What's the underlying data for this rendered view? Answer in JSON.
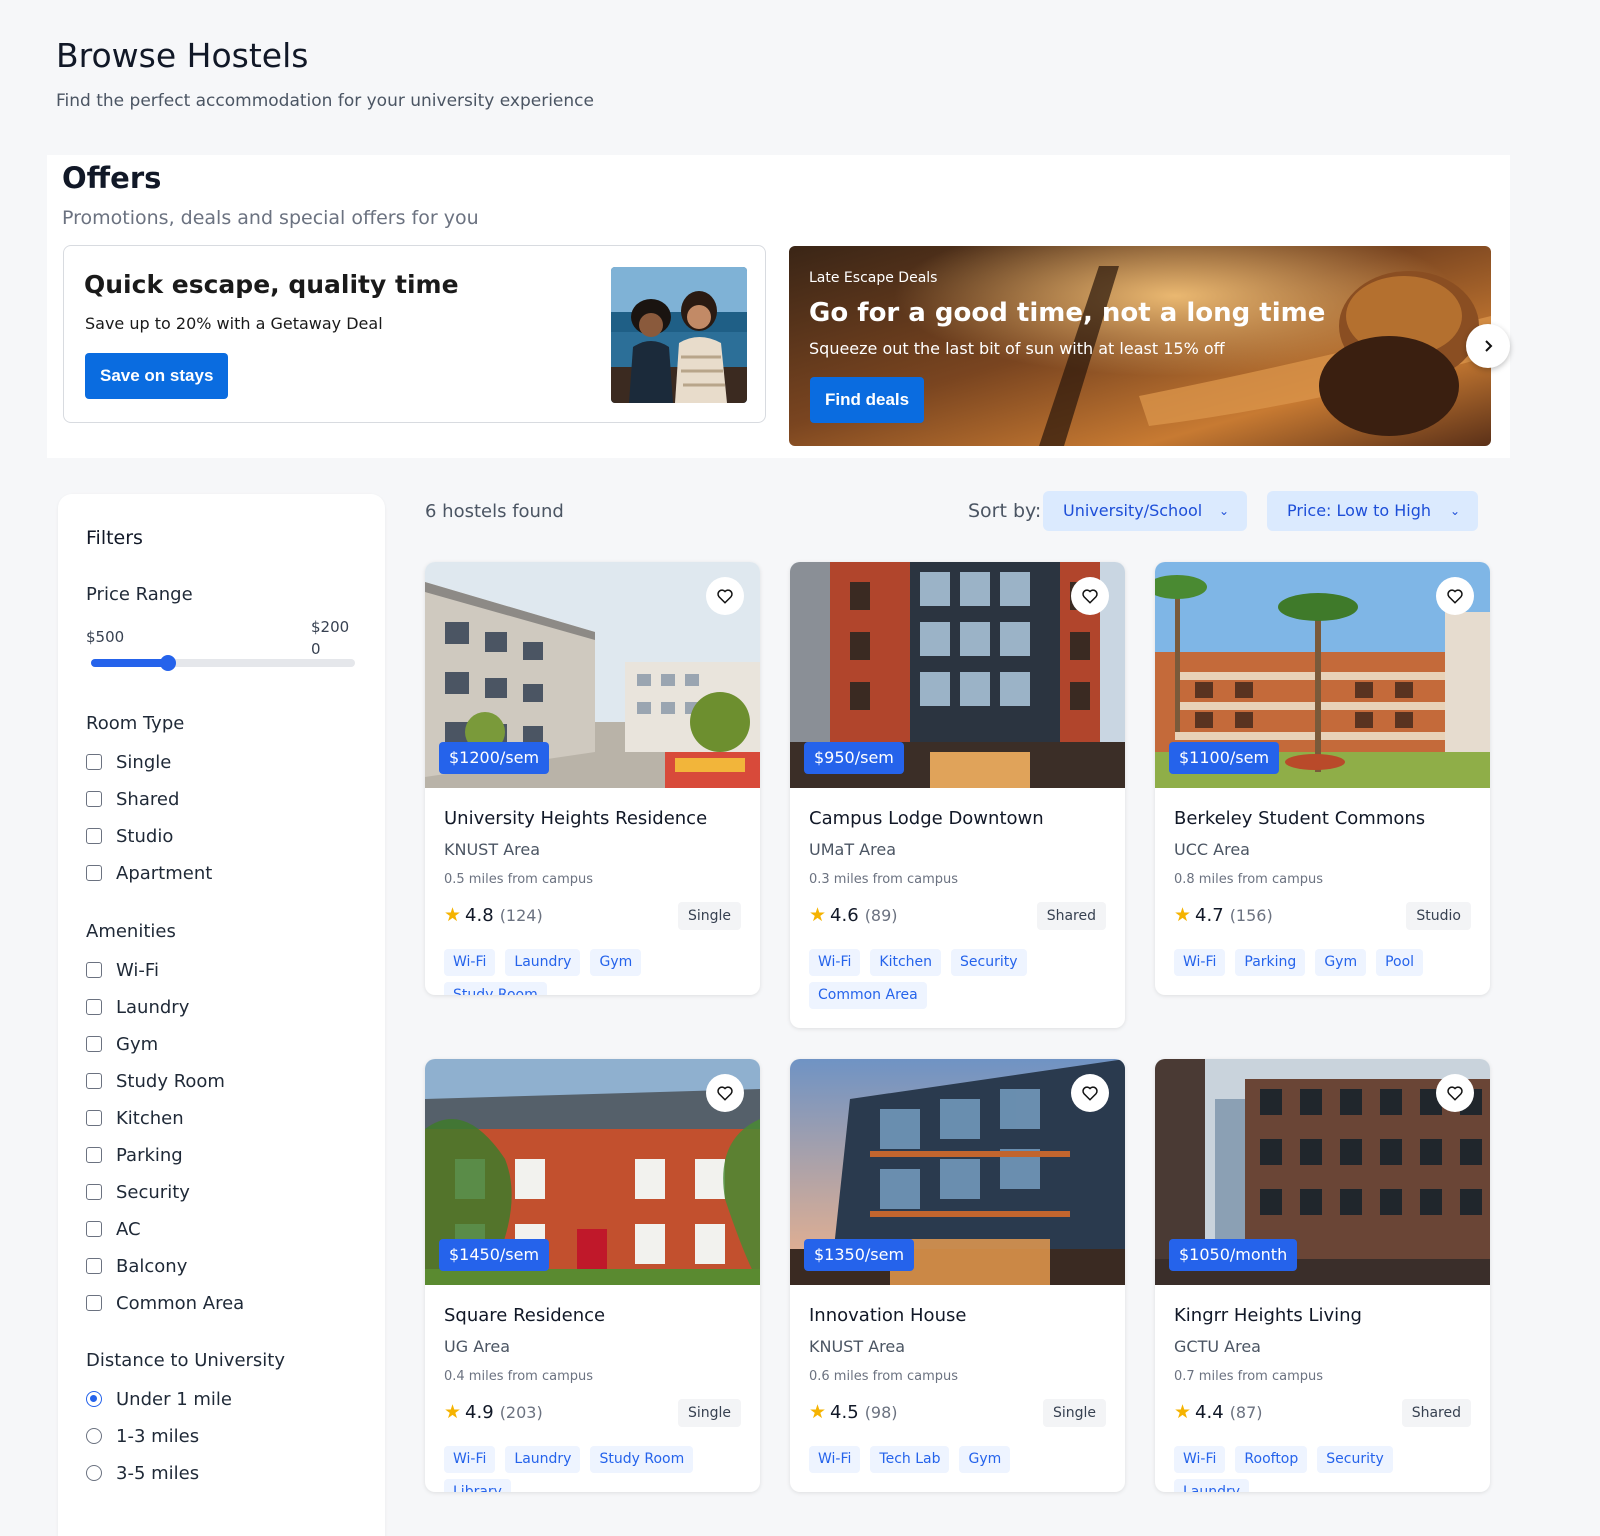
{
  "header": {
    "title": "Browse Hostels",
    "subtitle": "Find the perfect accommodation for your university experience"
  },
  "offers": {
    "title": "Offers",
    "subtitle": "Promotions, deals and special offers for you",
    "card": {
      "title": "Quick escape, quality time",
      "subtitle": "Save up to 20% with a Getaway Deal",
      "button": "Save on stays"
    },
    "banner": {
      "kicker": "Late Escape Deals",
      "title": "Go for a good time, not a long time",
      "subtitle": "Squeeze out the last bit of sun with at least 15% off",
      "button": "Find deals"
    }
  },
  "filters": {
    "title": "Filters",
    "price_range": {
      "label": "Price Range",
      "min_label": "$500",
      "max_label": "$2000",
      "value_fraction": 0.29
    },
    "room_type": {
      "label": "Room Type",
      "options": [
        "Single",
        "Shared",
        "Studio",
        "Apartment"
      ]
    },
    "amenities": {
      "label": "Amenities",
      "options": [
        "Wi-Fi",
        "Laundry",
        "Gym",
        "Study Room",
        "Kitchen",
        "Parking",
        "Security",
        "AC",
        "Balcony",
        "Common Area"
      ]
    },
    "distance": {
      "label": "Distance to University",
      "options": [
        "Under 1 mile",
        "1-3 miles",
        "3-5 miles"
      ],
      "selected": "Under 1 mile"
    }
  },
  "results": {
    "count_text": "6 hostels found",
    "sort_label": "Sort by:",
    "sort_university": "University/School",
    "sort_price": "Price: Low to High"
  },
  "hostels": [
    {
      "name": "University Heights Residence",
      "area": "KNUST Area",
      "distance": "0.5 miles from campus",
      "rating": "4.8",
      "reviews": "(124)",
      "type": "Single",
      "price": "$1200/sem",
      "amenities": [
        "Wi-Fi",
        "Laundry",
        "Gym",
        "Study Room"
      ]
    },
    {
      "name": "Campus Lodge Downtown",
      "area": "UMaT Area",
      "distance": "0.3 miles from campus",
      "rating": "4.6",
      "reviews": "(89)",
      "type": "Shared",
      "price": "$950/sem",
      "amenities": [
        "Wi-Fi",
        "Kitchen",
        "Security",
        "Common Area"
      ]
    },
    {
      "name": "Berkeley Student Commons",
      "area": "UCC Area",
      "distance": "0.8 miles from campus",
      "rating": "4.7",
      "reviews": "(156)",
      "type": "Studio",
      "price": "$1100/sem",
      "amenities": [
        "Wi-Fi",
        "Parking",
        "Gym",
        "Pool"
      ]
    },
    {
      "name": "Square Residence",
      "area": "UG Area",
      "distance": "0.4 miles from campus",
      "rating": "4.9",
      "reviews": "(203)",
      "type": "Single",
      "price": "$1450/sem",
      "amenities": [
        "Wi-Fi",
        "Laundry",
        "Study Room",
        "Library"
      ]
    },
    {
      "name": "Innovation House",
      "area": "KNUST Area",
      "distance": "0.6 miles from campus",
      "rating": "4.5",
      "reviews": "(98)",
      "type": "Single",
      "price": "$1350/sem",
      "amenities": [
        "Wi-Fi",
        "Tech Lab",
        "Gym"
      ]
    },
    {
      "name": "Kingrr Heights Living",
      "area": "GCTU Area",
      "distance": "0.7 miles from campus",
      "rating": "4.4",
      "reviews": "(87)",
      "type": "Shared",
      "price": "$1050/month",
      "amenities": [
        "Wi-Fi",
        "Rooftop",
        "Security",
        "Laundry"
      ]
    }
  ]
}
